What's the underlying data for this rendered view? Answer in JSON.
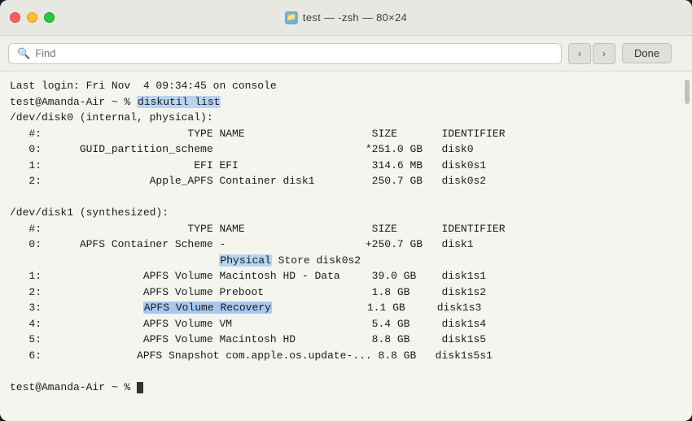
{
  "window": {
    "title": "test — -zsh — 80×24",
    "title_icon": "📁"
  },
  "toolbar": {
    "find_placeholder": "Find",
    "nav_prev": "‹",
    "nav_next": "›",
    "done_label": "Done"
  },
  "terminal": {
    "lines": [
      "Last login: Fri Nov  4 09:34:45 on console",
      "test@Amanda-Air ~ % diskutil list",
      "/dev/disk0 (internal, physical):",
      "   #:                       TYPE NAME                    SIZE       IDENTIFIER",
      "   0:      GUID_partition_scheme                        *251.0 GB   disk0",
      "   1:                        EFI EFI                     314.6 MB   disk0s1",
      "   2:                 Apple_APFS Container disk1         250.7 GB   disk0s2",
      "",
      "/dev/disk1 (synthesized):",
      "   #:                       TYPE NAME                    SIZE       IDENTIFIER",
      "   0:      APFS Container Scheme -                      +250.7 GB   disk1",
      "                                 Physical Store disk0s2",
      "   1:                APFS Volume Macintosh HD - Data     39.0 GB    disk1s1",
      "   2:                APFS Volume Preboot                 1.8 GB     disk1s2",
      "   3:                APFS Volume Recovery                1.1 GB     disk1s3",
      "   4:                APFS Volume VM                      5.4 GB     disk1s4",
      "   5:                APFS Volume Macintosh HD            8.8 GB     disk1s5",
      "   6:               APFS Snapshot com.apple.os.update-... 8.8 GB   disk1s5s1",
      "",
      "test@Amanda-Air ~ % "
    ],
    "highlight_command": "diskutil list",
    "highlight_recovery": "APFS Volume Recovery"
  }
}
